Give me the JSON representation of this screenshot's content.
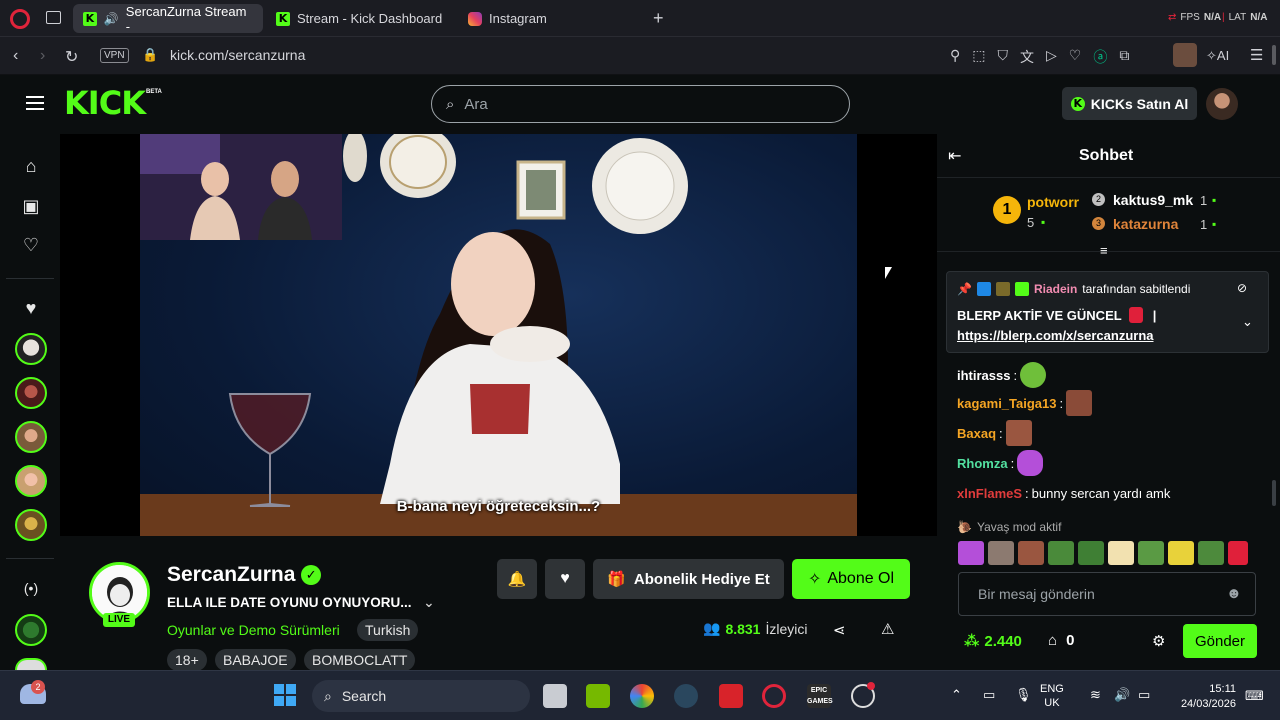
{
  "browser": {
    "tabs": [
      {
        "label": "SercanZurna Stream -",
        "active": true
      },
      {
        "label": "Stream - Kick Dashboard",
        "active": false
      },
      {
        "label": "Instagram",
        "active": false
      }
    ],
    "fps_label": "FPS",
    "fps_value": "N/A",
    "lat_label": "LAT",
    "lat_value": "N/A",
    "vpn_label": "VPN",
    "url": "kick.com/sercanzurna",
    "ai_label": "AI"
  },
  "header": {
    "logo": "KICK",
    "beta": "BETA",
    "search_placeholder": "Ara",
    "kicks_button": "KICKs Satın Al"
  },
  "video": {
    "subtitle": "B-bana neyi öğreteceksin...?"
  },
  "stream": {
    "name": "SercanZurna",
    "live_badge": "LIVE",
    "title": "ELLA ILE DATE OYUNU OYNUYORU...",
    "category": "Oyunlar ve Demo Sürümleri",
    "language": "Turkish",
    "tags": [
      "18+",
      "BABAJOE",
      "BOMBOCLATT"
    ],
    "gift_button": "Abonelik Hediye Et",
    "subscribe_button": "Abone Ol",
    "viewers_count": "8.831",
    "viewers_label": "İzleyici"
  },
  "chat": {
    "title": "Sohbet",
    "leaderboard": [
      {
        "rank": "1",
        "name": "potworr",
        "count": "5"
      },
      {
        "rank": "2",
        "name": "kaktus9_mk",
        "count": "1"
      },
      {
        "rank": "3",
        "name": "katazurna",
        "count": "1"
      }
    ],
    "pinned": {
      "pinned_by": "Riadein",
      "pinned_suffix": "tarafından sabitlendi",
      "message": "BLERP AKTİF VE GÜNCEL",
      "link": "https://blerp.com/x/sercanzurna"
    },
    "messages": [
      {
        "user": "ihtirasss",
        "text": "",
        "color": "#ffffff"
      },
      {
        "user": "kagami_Taiga13",
        "text": "",
        "color": "#f5a524"
      },
      {
        "user": "Baxaq",
        "text": "",
        "color": "#f5a524"
      },
      {
        "user": "Rhomza",
        "text": "",
        "color": "#53e0a0"
      },
      {
        "user": "xlnFlameS",
        "text": "bunny sercan yardı amk",
        "color": "#e03c3c"
      }
    ],
    "slow_mode": "Yavaş mod aktif",
    "input_placeholder": "Bir mesaj gönderin",
    "points": "2.440",
    "gift_count": "0",
    "send_button": "Gönder"
  },
  "taskbar": {
    "search_label": "Search",
    "notification_badge": "2",
    "lang_line1": "ENG",
    "lang_line2": "UK",
    "time": "15:11",
    "date": "24/03/2026",
    "epic_label": "EPIC GAMES"
  },
  "colors": {
    "kick_green": "#53fc18",
    "background": "#0b0e0f",
    "panel": "#2f3336"
  }
}
